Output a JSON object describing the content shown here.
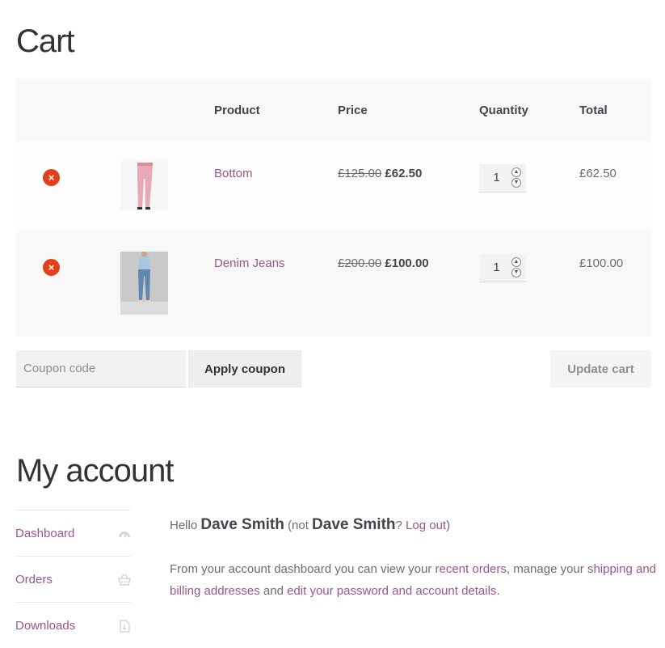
{
  "cart": {
    "title": "Cart",
    "headers": {
      "product": "Product",
      "price": "Price",
      "quantity": "Quantity",
      "total": "Total"
    },
    "items": [
      {
        "name": "Bottom",
        "regular_price": "£125.00",
        "sale_price": "£62.50",
        "quantity": "1",
        "total": "£62.50",
        "image_icon": "pink-trousers-image"
      },
      {
        "name": "Denim Jeans",
        "regular_price": "£200.00",
        "sale_price": "£100.00",
        "quantity": "1",
        "total": "£100.00",
        "image_icon": "denim-jeans-image"
      }
    ],
    "remove_icon": "×",
    "coupon_placeholder": "Coupon code",
    "apply_coupon_label": "Apply coupon",
    "update_cart_label": "Update cart",
    "colors": {
      "remove": "#e2401c",
      "link": "#96588a"
    }
  },
  "account": {
    "title": "My account",
    "nav": [
      {
        "label": "Dashboard",
        "icon": "dashboard-gauge-icon"
      },
      {
        "label": "Orders",
        "icon": "basket-icon"
      },
      {
        "label": "Downloads",
        "icon": "file-download-icon"
      }
    ],
    "hello_prefix": "Hello ",
    "user_name": "Dave Smith",
    "not_prefix": " (not ",
    "not_suffix": "? ",
    "logout_label": "Log out",
    "close_paren": ")",
    "intro_1": "From your account dashboard you can view your ",
    "recent_orders": "recent orders",
    "intro_2": ", manage your ",
    "shipping_link": "shipping and billing addresses",
    "intro_3": " and ",
    "edit_link": "edit your password and account details",
    "intro_4": "."
  }
}
